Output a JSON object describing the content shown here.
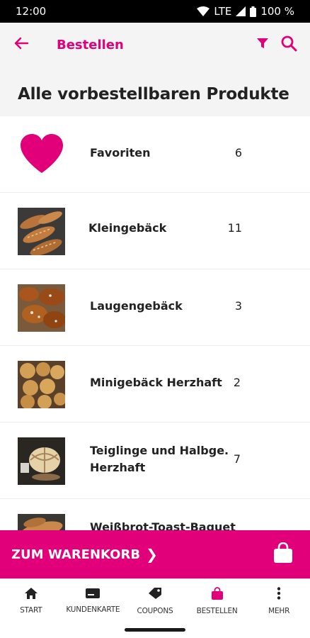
{
  "status_bar": {
    "time": "12:00",
    "network": "LTE",
    "battery": "100 %"
  },
  "app_bar": {
    "title": "Bestellen",
    "icons": [
      "arrow-back-icon",
      "filter-icon",
      "search-icon"
    ]
  },
  "section": {
    "title": "Alle vorbestellbaren Produkte"
  },
  "categories": [
    {
      "name": "Favoriten",
      "count": "6",
      "icon": "heart-icon"
    },
    {
      "name": "Kleingebäck",
      "count": "11"
    },
    {
      "name": "Laugengebäck",
      "count": "3"
    },
    {
      "name": "Minigebäck Herzhaft",
      "count": "2"
    },
    {
      "name": "Teiglinge und Halbge. Herzhaft",
      "count": "7"
    },
    {
      "name": "Weißbrot-Toast-Baguet",
      "count": ""
    }
  ],
  "cart": {
    "label": "ZUM WARENKORB",
    "arrow": "❯",
    "icon": "shopping-bag-icon"
  },
  "bottom_nav": [
    {
      "label": "START",
      "icon": "home-icon"
    },
    {
      "label": "KUNDENKARTE",
      "icon": "card-icon"
    },
    {
      "label": "COUPONS",
      "icon": "tag-icon"
    },
    {
      "label": "BESTELLEN",
      "icon": "shopping-bag-icon",
      "active": true
    },
    {
      "label": "MEHR",
      "icon": "more-vert-icon"
    }
  ],
  "colors": {
    "accent": "#e2007a",
    "header_bg": "#f4f4f4",
    "status_bar": "#000000"
  }
}
